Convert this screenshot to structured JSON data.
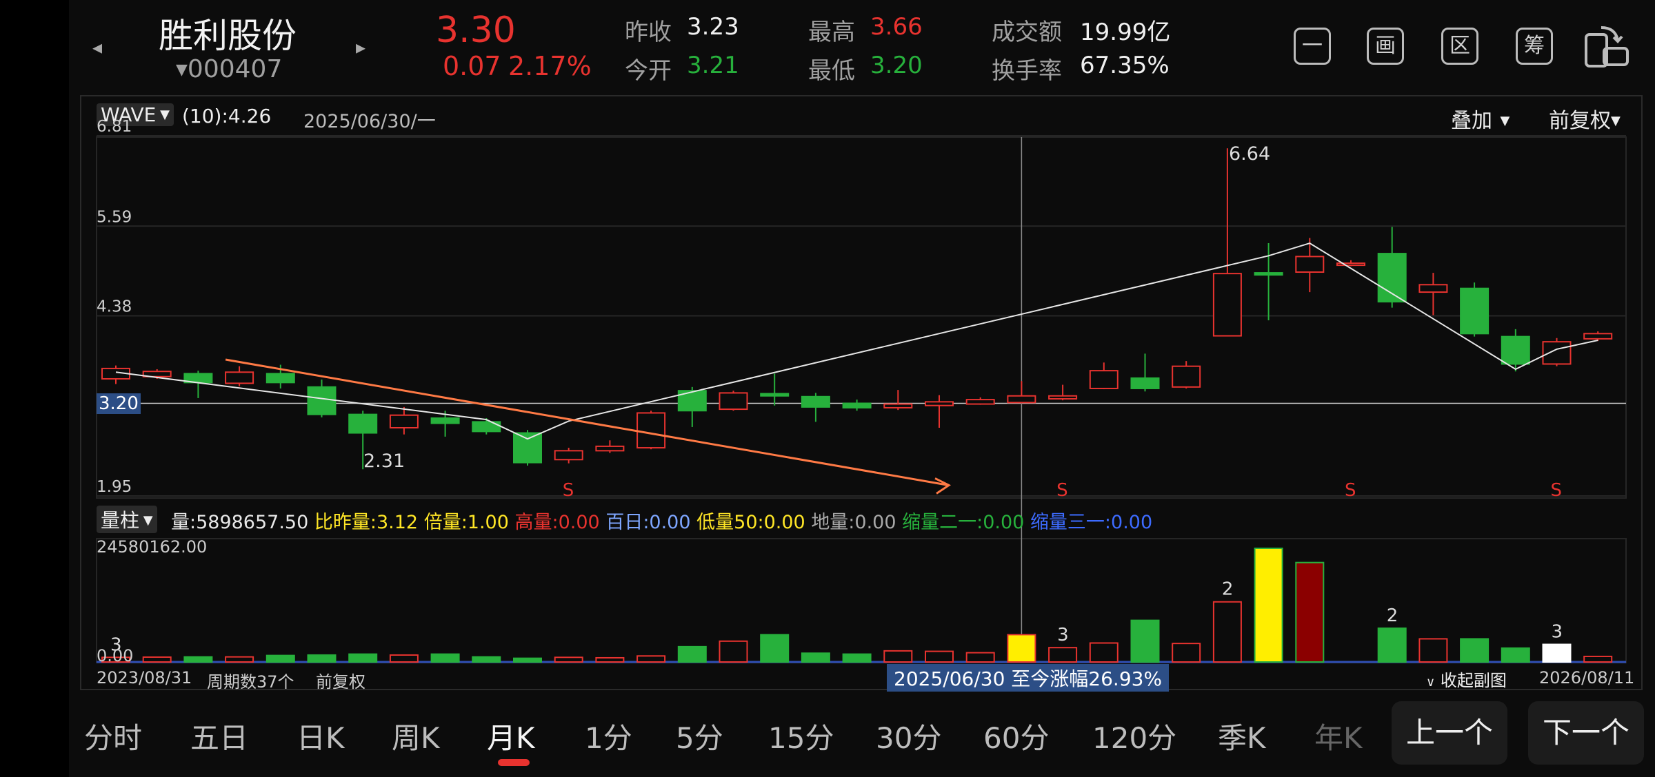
{
  "header": {
    "stock_name": "胜利股份",
    "stock_code": "000407",
    "price": "3.30",
    "change": "0.07",
    "change_pct": "2.17%",
    "stats": {
      "prev_close_label": "昨收",
      "prev_close": "3.23",
      "open_label": "今开",
      "open": "3.21",
      "high_label": "最高",
      "high": "3.66",
      "low_label": "最低",
      "low": "3.20",
      "amount_label": "成交额",
      "amount": "19.99亿",
      "turnover_label": "换手率",
      "turnover": "67.35%"
    },
    "toolbar": [
      "一",
      "画",
      "区",
      "筹"
    ],
    "colors": {
      "up": "#e8332f",
      "down": "#27b13c"
    }
  },
  "main_panel": {
    "indicator": "WAVE",
    "indicator_param": "(10):4.26",
    "cursor_date": "2025/06/30/一",
    "overlay_label": "叠加",
    "adjust_label": "前复权",
    "current_price_tag": "3.20",
    "annotations": {
      "high": "6.64",
      "low": "2.31",
      "signal": "S"
    }
  },
  "volume_panel": {
    "selector": "量柱",
    "indicators": [
      {
        "label": "量:5898657.50",
        "color": "#e8e8e8"
      },
      {
        "label": "比昨量:3.12",
        "color": "#ffe626"
      },
      {
        "label": "倍量:1.00",
        "color": "#ffe626"
      },
      {
        "label": "高量:0.00",
        "color": "#e8332f"
      },
      {
        "label": "百日:0.00",
        "color": "#7ea6ff"
      },
      {
        "label": "低量50:0.00",
        "color": "#ffe626"
      },
      {
        "label": "地量:0.00",
        "color": "#a8a8a8"
      },
      {
        "label": "缩量二一:0.00",
        "color": "#27b13c"
      },
      {
        "label": "缩量三一:0.00",
        "color": "#3d6bff"
      }
    ],
    "max_label": "24580162.00",
    "min_label": "0.00",
    "bar_marks": [
      "3",
      "3",
      "2",
      "2",
      "3"
    ]
  },
  "footer": {
    "start_date": "2023/08/31",
    "period_count": "周期数37个",
    "adjust": "前复权",
    "range_info": "2025/06/30 至今涨幅26.93%",
    "collapse": "收起副图",
    "end_date": "2026/08/11"
  },
  "tabs": [
    "分时",
    "五日",
    "日K",
    "周K",
    "月K",
    "1分",
    "5分",
    "15分",
    "30分",
    "60分",
    "120分",
    "季K",
    "年K"
  ],
  "active_tab": "月K",
  "nav": {
    "prev": "上一个",
    "next": "下一个"
  },
  "chart_data": {
    "type": "candlestick",
    "y_axis_labels": [
      "6.81",
      "5.59",
      "4.38",
      "3.20",
      "1.95"
    ],
    "ylim": [
      1.95,
      6.81
    ],
    "candles": [
      {
        "o": 3.53,
        "c": 3.67,
        "h": 3.71,
        "l": 3.46,
        "v": 1000000
      },
      {
        "o": 3.56,
        "c": 3.63,
        "h": 3.66,
        "l": 3.53,
        "v": 1050000
      },
      {
        "o": 3.6,
        "c": 3.48,
        "h": 3.64,
        "l": 3.27,
        "v": 1100000
      },
      {
        "o": 3.47,
        "c": 3.62,
        "h": 3.7,
        "l": 3.43,
        "v": 1100000
      },
      {
        "o": 3.6,
        "c": 3.48,
        "h": 3.72,
        "l": 3.4,
        "v": 1400000
      },
      {
        "o": 3.42,
        "c": 3.05,
        "h": 3.52,
        "l": 3.01,
        "v": 1500000
      },
      {
        "o": 3.05,
        "c": 2.8,
        "h": 3.1,
        "l": 2.31,
        "v": 1700000
      },
      {
        "o": 2.87,
        "c": 3.04,
        "h": 3.15,
        "l": 2.78,
        "v": 1500000
      },
      {
        "o": 3.0,
        "c": 2.93,
        "h": 3.1,
        "l": 2.75,
        "v": 1700000
      },
      {
        "o": 2.95,
        "c": 2.82,
        "h": 3.0,
        "l": 2.78,
        "v": 1100000
      },
      {
        "o": 2.8,
        "c": 2.4,
        "h": 2.84,
        "l": 2.36,
        "v": 800000
      },
      {
        "o": 2.44,
        "c": 2.56,
        "h": 2.6,
        "l": 2.39,
        "v": 1000000
      },
      {
        "o": 2.56,
        "c": 2.62,
        "h": 2.7,
        "l": 2.53,
        "v": 900000
      },
      {
        "o": 2.6,
        "c": 3.07,
        "h": 3.1,
        "l": 2.58,
        "v": 1300000
      },
      {
        "o": 3.37,
        "c": 3.1,
        "h": 3.42,
        "l": 2.88,
        "v": 3300000
      },
      {
        "o": 3.12,
        "c": 3.34,
        "h": 3.37,
        "l": 3.1,
        "v": 4500000
      },
      {
        "o": 3.33,
        "c": 3.3,
        "h": 3.6,
        "l": 3.17,
        "v": 5900000
      },
      {
        "o": 3.29,
        "c": 3.15,
        "h": 3.34,
        "l": 2.95,
        "v": 1900000
      },
      {
        "o": 3.2,
        "c": 3.14,
        "h": 3.25,
        "l": 3.1,
        "v": 1700000
      },
      {
        "o": 3.14,
        "c": 3.19,
        "h": 3.38,
        "l": 3.11,
        "v": 2400000
      },
      {
        "o": 3.17,
        "c": 3.22,
        "h": 3.31,
        "l": 2.87,
        "v": 2300000
      },
      {
        "o": 3.19,
        "c": 3.25,
        "h": 3.28,
        "l": 3.18,
        "v": 2000000
      },
      {
        "o": 3.21,
        "c": 3.3,
        "h": 3.5,
        "l": 3.2,
        "v": 5900000
      },
      {
        "o": 3.26,
        "c": 3.3,
        "h": 3.45,
        "l": 3.24,
        "v": 3100000
      },
      {
        "o": 3.4,
        "c": 3.64,
        "h": 3.75,
        "l": 3.39,
        "v": 4100000
      },
      {
        "o": 3.54,
        "c": 3.4,
        "h": 3.87,
        "l": 3.36,
        "v": 9000000
      },
      {
        "o": 3.42,
        "c": 3.7,
        "h": 3.77,
        "l": 3.4,
        "v": 4000000
      },
      {
        "o": 4.11,
        "c": 4.95,
        "h": 6.64,
        "l": 4.11,
        "v": 13000000
      },
      {
        "o": 4.96,
        "c": 4.94,
        "h": 5.36,
        "l": 4.32,
        "v": 24580162
      },
      {
        "o": 4.97,
        "c": 5.18,
        "h": 5.43,
        "l": 4.7,
        "v": 21500000
      },
      {
        "o": 5.08,
        "c": 5.09,
        "h": 5.13,
        "l": 5.05,
        "v": 0
      },
      {
        "o": 5.22,
        "c": 4.57,
        "h": 5.58,
        "l": 4.49,
        "v": 7300000
      },
      {
        "o": 4.7,
        "c": 4.8,
        "h": 4.96,
        "l": 4.39,
        "v": 5000000
      },
      {
        "o": 4.75,
        "c": 4.14,
        "h": 4.83,
        "l": 4.1,
        "v": 5000000
      },
      {
        "o": 4.1,
        "c": 3.73,
        "h": 4.2,
        "l": 3.63,
        "v": 3000000
      },
      {
        "o": 3.73,
        "c": 4.03,
        "h": 4.08,
        "l": 3.7,
        "v": 3800000
      },
      {
        "o": 4.07,
        "c": 4.14,
        "h": 4.17,
        "l": 4.04,
        "v": 1200000
      }
    ],
    "wave_line": [
      [
        0,
        3.62
      ],
      [
        9,
        2.98
      ],
      [
        10,
        2.72
      ],
      [
        11,
        2.96
      ],
      [
        28,
        5.19
      ],
      [
        29,
        5.36
      ],
      [
        34,
        3.66
      ],
      [
        35,
        3.93
      ],
      [
        36,
        4.05
      ]
    ],
    "trend_line": [
      [
        3,
        3.79
      ],
      [
        20,
        2.02
      ]
    ],
    "signals": [
      11,
      23,
      30,
      35
    ],
    "price_line": 3.2,
    "cursor_index": 22
  }
}
